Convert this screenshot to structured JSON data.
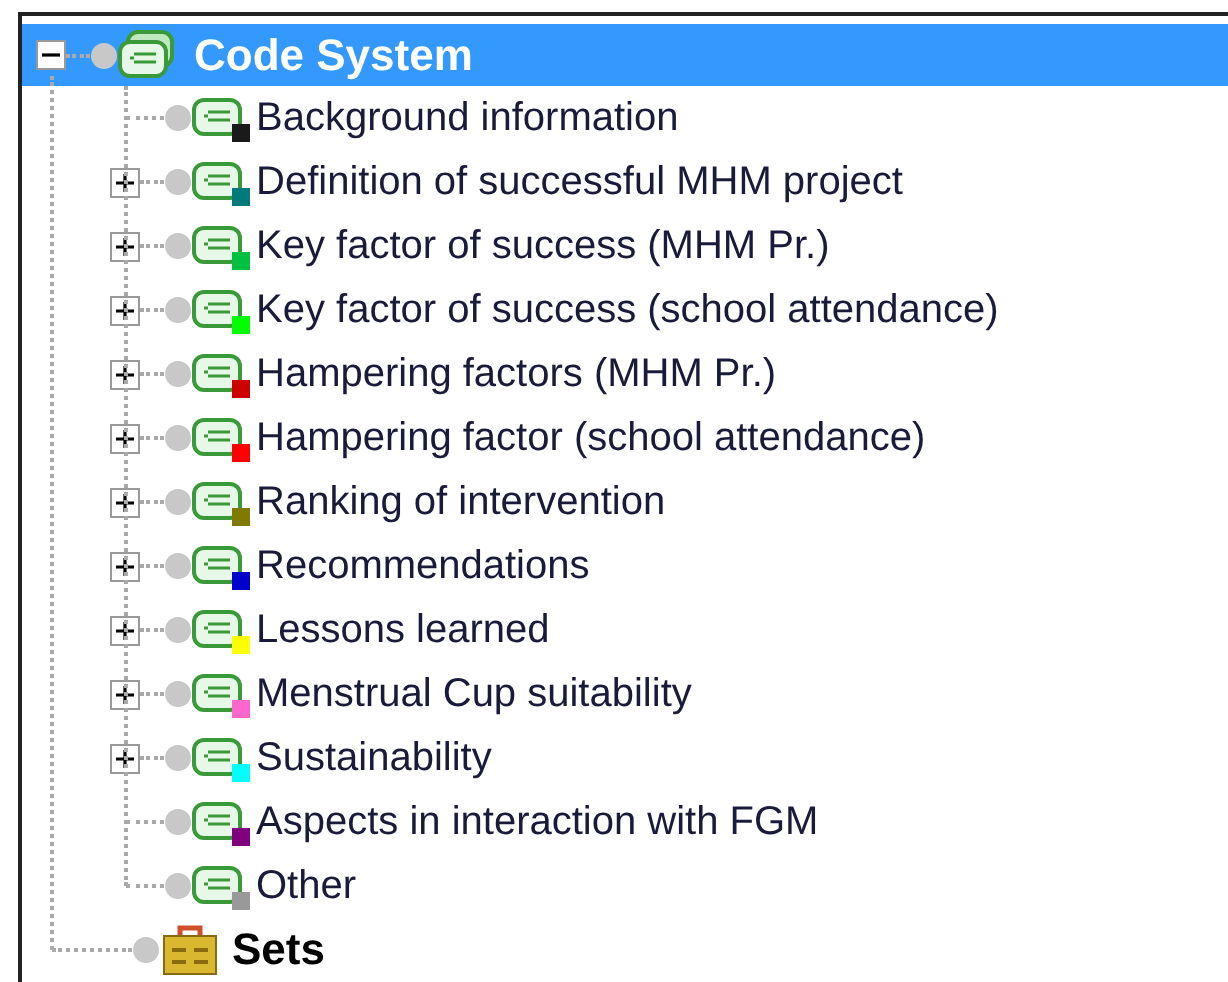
{
  "code_system": {
    "label": "Code System",
    "expanded": true,
    "selected": true,
    "children": [
      {
        "label": "Background information",
        "color": "#1a1a1a",
        "expandable": false
      },
      {
        "label": "Definition of successful MHM project",
        "color": "#007a7a",
        "expandable": true
      },
      {
        "label": "Key factor of success (MHM Pr.)",
        "color": "#00c040",
        "expandable": true
      },
      {
        "label": "Key factor of success (school attendance)",
        "color": "#00ff00",
        "expandable": true
      },
      {
        "label": "Hampering factors (MHM Pr.)",
        "color": "#cc0000",
        "expandable": true
      },
      {
        "label": "Hampering factor (school attendance)",
        "color": "#ff0000",
        "expandable": true
      },
      {
        "label": "Ranking of intervention",
        "color": "#7f7a00",
        "expandable": true
      },
      {
        "label": "Recommendations",
        "color": "#0000cc",
        "expandable": true
      },
      {
        "label": "Lessons learned",
        "color": "#ffff00",
        "expandable": true
      },
      {
        "label": "Menstrual Cup suitability",
        "color": "#ff66cc",
        "expandable": true
      },
      {
        "label": "Sustainability",
        "color": "#00ffff",
        "expandable": true
      },
      {
        "label": "Aspects in interaction with FGM",
        "color": "#800080",
        "expandable": false
      },
      {
        "label": "Other",
        "color": "#999999",
        "expandable": false
      }
    ]
  },
  "sets": {
    "label": "Sets"
  }
}
